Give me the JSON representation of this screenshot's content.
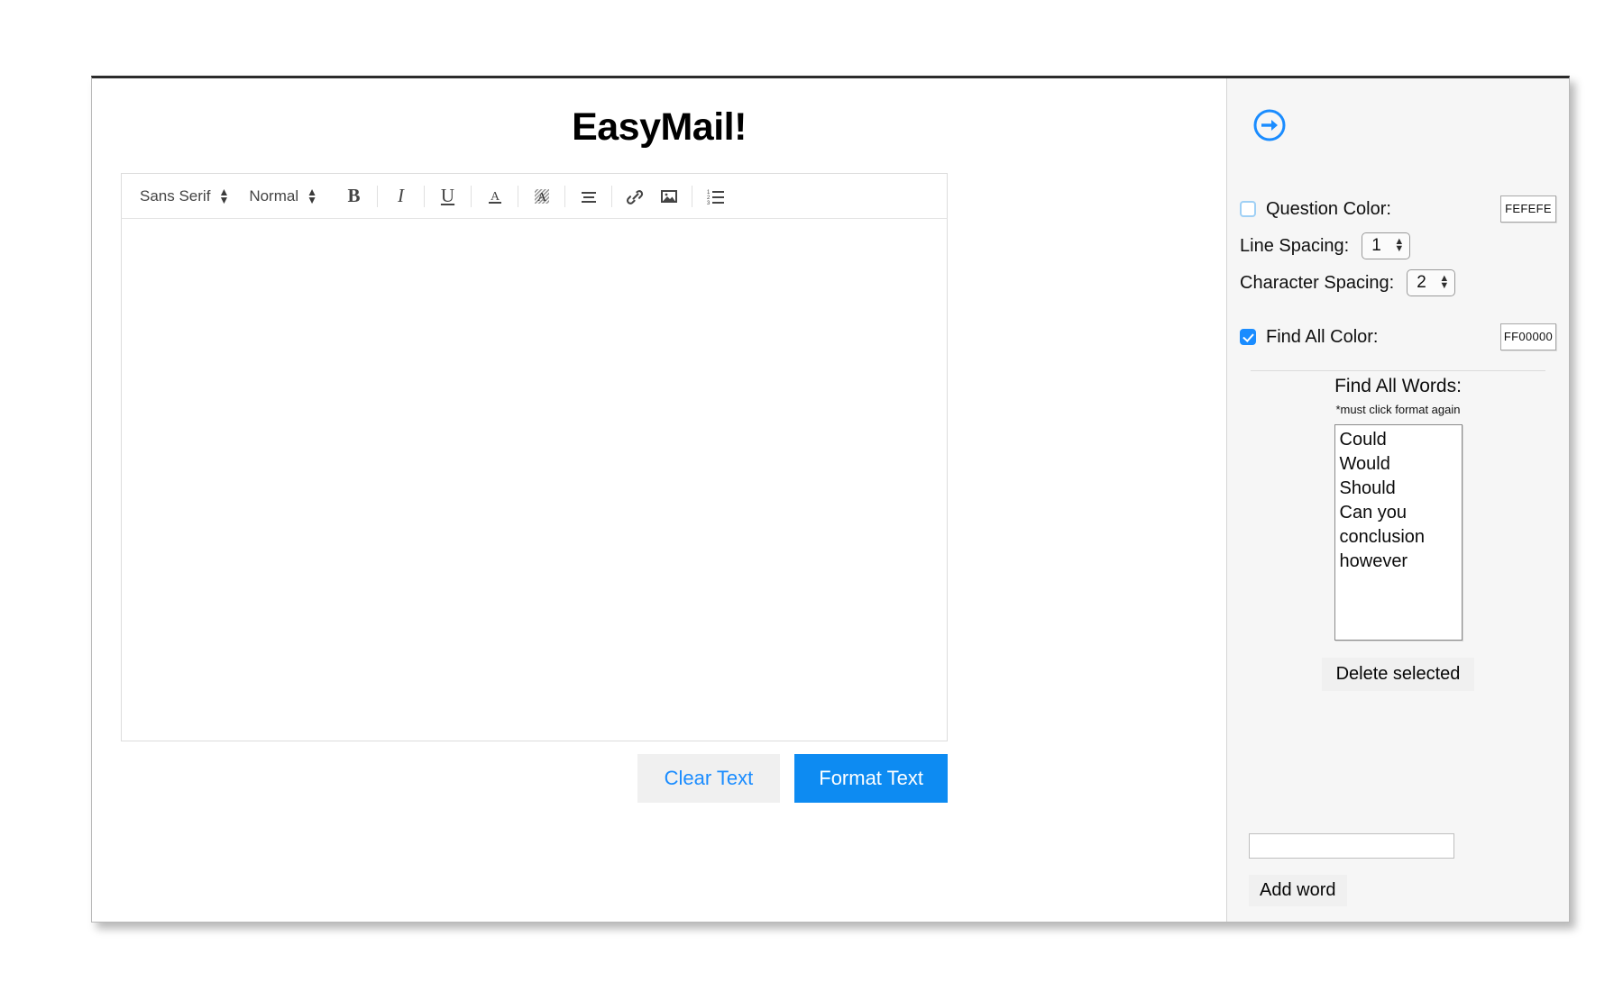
{
  "app": {
    "title": "EasyMail!"
  },
  "editor": {
    "toolbar": {
      "font_family": "Sans Serif",
      "font_size": "Normal",
      "bold": "B",
      "italic": "I",
      "underline": "U",
      "text_color_icon": "text-color-a-icon",
      "background_color_icon": "background-color-a-icon",
      "align_icon": "align-left-icon",
      "link_icon": "link-icon",
      "image_icon": "image-icon",
      "ordered_list_icon": "ordered-list-icon"
    },
    "content": "",
    "placeholder": ""
  },
  "actions": {
    "clear_label": "Clear Text",
    "format_label": "Format Text",
    "clear_text_color": "#1a8cff",
    "format_bg_color": "#0d8bf2"
  },
  "sidebar": {
    "collapse_icon": "arrow-right-circle-icon",
    "accent_color": "#1a8cff",
    "question_color": {
      "label": "Question Color:",
      "checked": false,
      "value": "FEFEFE"
    },
    "line_spacing": {
      "label": "Line Spacing:",
      "value": "1"
    },
    "character_spacing": {
      "label": "Character Spacing:",
      "value": "2"
    },
    "find_all_color": {
      "label": "Find All Color:",
      "checked": true,
      "value": "FF00000"
    },
    "find_all_words": {
      "title": "Find All Words:",
      "note": "*must click format again",
      "words": [
        "Could",
        "Would",
        "Should",
        "Can you",
        "conclusion",
        "however"
      ],
      "delete_label": "Delete selected",
      "input_value": "",
      "add_label": "Add word"
    }
  }
}
